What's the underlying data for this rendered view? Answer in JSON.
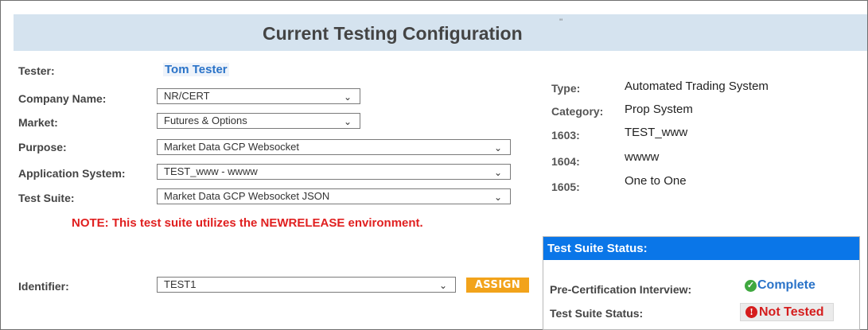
{
  "header": {
    "title": "Current Testing Configuration",
    "mark": "''"
  },
  "form": {
    "tester_label": "Tester:",
    "tester_name": "Tom Tester",
    "company_label": "Company Name:",
    "company_value": "NR/CERT",
    "market_label": "Market:",
    "market_value": "Futures & Options",
    "purpose_label": "Purpose:",
    "purpose_value": "Market Data GCP Websocket",
    "appsys_label": "Application System:",
    "appsys_value": "TEST_www - wwww",
    "suite_label": "Test Suite:",
    "suite_value": "Market Data GCP Websocket JSON",
    "note": "NOTE: This test suite utilizes the NEWRELEASE environment.",
    "identifier_label": "Identifier:",
    "identifier_value": "TEST1",
    "assign_label": "ASSIGN"
  },
  "details": {
    "type_label": "Type:",
    "type_value": "Automated Trading System",
    "category_label": "Category:",
    "category_value": "Prop System",
    "f1603_label": "1603:",
    "f1603_value": "TEST_www",
    "f1604_label": "1604:",
    "f1604_value": "wwww",
    "f1605_label": "1605:",
    "f1605_value": "One to One"
  },
  "status": {
    "heading": "Test Suite Status:",
    "interview_label": "Pre-Certification Interview:",
    "interview_value": "Complete",
    "suite_status_label": "Test Suite Status:",
    "suite_status_value": "Not Tested"
  },
  "icons": {
    "select": "chevron-down-icon",
    "complete": "check-circle-icon",
    "not_tested": "exclamation-circle-icon"
  },
  "colors": {
    "header_bg": "#d5e3ef",
    "status_head": "#0a76e8",
    "note": "#e02020",
    "assign": "#f2a31b",
    "link": "#2a73c8"
  }
}
